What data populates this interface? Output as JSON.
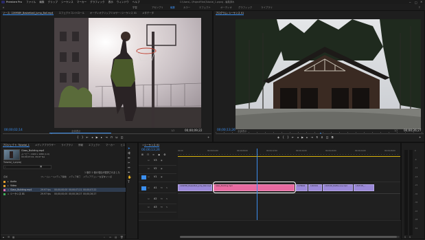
{
  "app": {
    "name": "Premiere Pro",
    "menu": [
      "ファイル",
      "編集",
      "クリップ",
      "シーケンス",
      "マーカー",
      "グラフィック",
      "表示",
      "ウィンドウ",
      "ヘルプ"
    ],
    "title": "C:\\Users\\...\\ProjectFiles\\Tutorial_1.prproj - 編集済み"
  },
  "workspaces": {
    "items": [
      "学習",
      "アセンブリ",
      "編集",
      "カラー",
      "エフェクト",
      "オーディオ",
      "グラフィック",
      "ライブラリ"
    ],
    "active": "編集"
  },
  "source": {
    "tabs": [
      "ソース: 1269589_Basketball_Jump_Ball.mp4",
      "エフェクトコントロール",
      "オーディオクリップミキサー: シーケンス 01",
      "メタデータ"
    ],
    "timecode_left": "00;00;02;14",
    "fit": "全体表示",
    "fraction": "1/2",
    "timecode_right": "00;00;09;22"
  },
  "program": {
    "tabs": [
      "プログラム: シーケンス 01"
    ],
    "timecode_left": "00;00;13;26",
    "fit": "全体表示",
    "fraction": "1/2",
    "timecode_right": "00;00;26;27"
  },
  "project": {
    "tabs": [
      "プロジェクト: Tutorial_1",
      "メディアブラウザー",
      "ライブラリ",
      "情報",
      "エフェクト",
      "マーカー",
      "ヒストリー"
    ],
    "selected_file": "Glass_Building.mp4",
    "meta_line1": "ムービー, 1920 x 1080 (1.0)",
    "meta_line2": "00;00;07;22, 29.97 fps",
    "search_placeholder": "",
    "selected_info": "1 個中 1 個の項目が選択されました",
    "bin_name": "Tutorial_1.prproj",
    "columns": [
      "名前",
      "フレームレート",
      "メディア開始",
      "メディア終了",
      "メディアデュレーション",
      "ビデオイン点"
    ],
    "rows": [
      {
        "name": "Audio",
        "color": "#e3a02e",
        "rate": "",
        "start": "",
        "end": "",
        "dur": ""
      },
      {
        "name": "Video",
        "color": "#e3a02e",
        "rate": "",
        "start": "",
        "end": "",
        "dur": ""
      },
      {
        "name": "Glass_Building.mp4",
        "color": "#e66bb8",
        "rate": "29.97 fps",
        "start": "00;00;00;00",
        "end": "00;00;07;21",
        "dur": "00;00;07;22"
      },
      {
        "name": "シーケンス 01",
        "color": "#3fb05a",
        "rate": "29.97 fps",
        "start": "00;00;00;00",
        "end": "00;00;26;27",
        "dur": "00;00;26;27"
      }
    ]
  },
  "timeline": {
    "tab": "シーケンス 01",
    "timecode": "00;00;13;26",
    "ruler": [
      "00;00",
      "00;00;04;00",
      "00;00;08;00",
      "00;00;12;00",
      "00;00;16;00",
      "00;00;20;00",
      "00;00;24;00",
      "00;00;28;00"
    ],
    "tracks": [
      "V3",
      "V2",
      "V1",
      "A1",
      "A2",
      "A3"
    ],
    "clips": [
      {
        "label": "1269589_Basketball_Jump_Ball.mp4"
      },
      {
        "label": "Glass_Building.mp4",
        "selected": true
      },
      {
        "label": "1278694"
      },
      {
        "label": "1263491"
      },
      {
        "label": "1263492_BallBounce.mp4"
      },
      {
        "label": "1365705_..."
      }
    ],
    "meter_labels": [
      "0",
      "-6",
      "-12",
      "-18",
      "-24",
      "-30",
      "-36",
      "-42",
      "-48",
      "-54"
    ]
  },
  "colors": {
    "accent": "#3b8ff0",
    "timecode": "#3b8ff0",
    "clip_video": "#9a88d8",
    "clip_selected": "#e86aa0",
    "selection_outline": "#ffffff"
  }
}
